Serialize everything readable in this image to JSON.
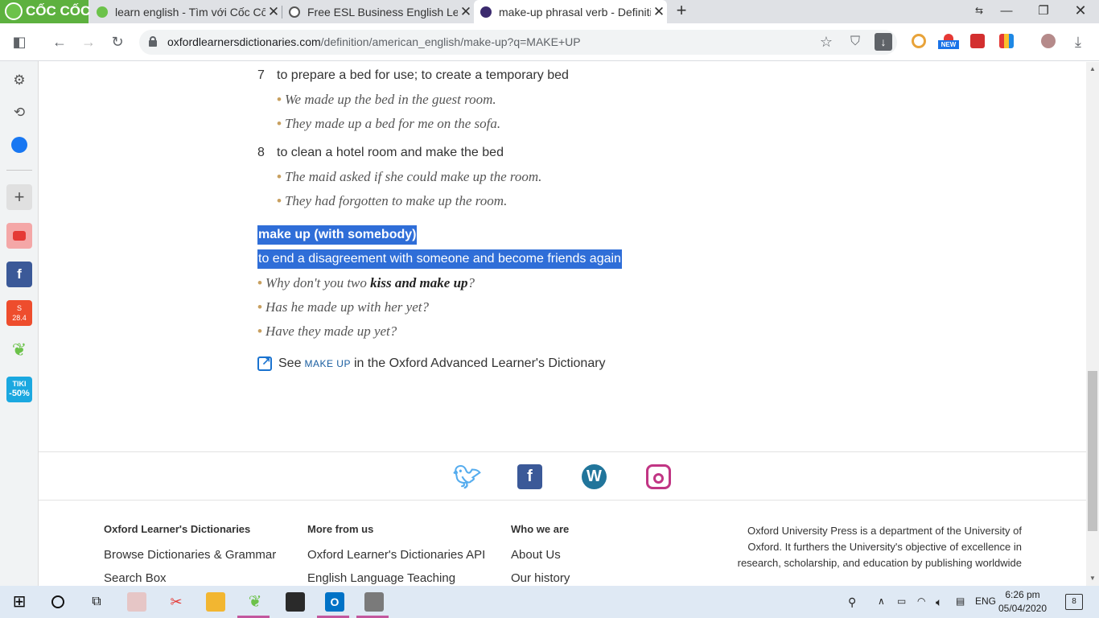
{
  "browser": {
    "brand": "CỐC CỐC",
    "tabs": [
      {
        "title": "learn english - Tìm với Cốc Cốc"
      },
      {
        "title": "Free ESL Business English Lessons"
      },
      {
        "title": "make-up phrasal verb - Definition"
      }
    ],
    "url_host": "oxfordlearnersdictionaries.com",
    "url_path": "/definition/american_english/make-up?q=MAKE+UP",
    "ext_badge": "NEW"
  },
  "entry": {
    "senses": [
      {
        "number": "7",
        "definition": "to prepare a bed for use; to create a temporary bed",
        "examples": [
          "We made up the bed in the guest room.",
          "They made up a bed for me on the sofa."
        ]
      },
      {
        "number": "8",
        "definition": "to clean a hotel room and make the bed",
        "examples": [
          "The maid asked if she could make up the room.",
          "They had forgotten to make up the room."
        ]
      }
    ],
    "phrase": {
      "headword": "make up (with somebody)",
      "definition": "to end a disagreement with someone and become friends again",
      "example1_pre": "Why don't you two ",
      "example1_bold": "kiss and make up",
      "example1_post": "?",
      "example2": "Has he made up with her yet?",
      "example3": "Have they made up yet?"
    },
    "see_also": {
      "prefix": "See",
      "link": "make up",
      "suffix": "in the Oxford Advanced Learner's Dictionary"
    }
  },
  "footer": {
    "col1": {
      "heading": "Oxford Learner's Dictionaries",
      "links": [
        "Browse Dictionaries & Grammar",
        "Search Box"
      ]
    },
    "col2": {
      "heading": "More from us",
      "links": [
        "Oxford Learner's Dictionaries API",
        "English Language Teaching"
      ]
    },
    "col3": {
      "heading": "Who we are",
      "links": [
        "About Us",
        "Our history"
      ]
    },
    "oup": "Oxford University Press is a department of the University of Oxford. It furthers the University's objective of excellence in research, scholarship, and education by publishing worldwide"
  },
  "sidebar_badges": {
    "shopee": "28.4",
    "tiki_line1": "TIKI",
    "tiki_line2": "-50%"
  },
  "taskbar": {
    "lang": "ENG",
    "time": "6:26 pm",
    "date": "05/04/2020",
    "notifications": "8"
  },
  "colors": {
    "selection": "#2f6ed8",
    "twitter": "#55acee",
    "facebook": "#3b5998",
    "wordpress": "#21759b",
    "instagram": "#c13584"
  }
}
